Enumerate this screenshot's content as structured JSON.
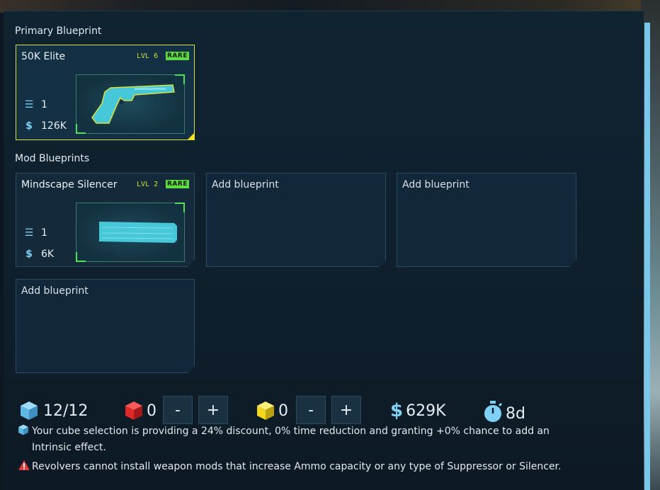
{
  "primary": {
    "section_title": "Primary Blueprint",
    "name": "50K Elite",
    "level": "LVL 6",
    "rarity": "RARE",
    "quantity": "1",
    "price": "126K"
  },
  "mods": {
    "section_title": "Mod Blueprints",
    "items": [
      {
        "name": "Mindscape Silencer",
        "level": "LVL 2",
        "rarity": "RARE",
        "quantity": "1",
        "price": "6K"
      }
    ],
    "add_labels": [
      "Add blueprint",
      "Add blueprint",
      "Add blueprint"
    ]
  },
  "resources": {
    "blue_cubes": "12/12",
    "red_cubes": "0",
    "yellow_cubes": "0",
    "minus_label": "-",
    "plus_label": "+",
    "credits": "629K",
    "time": "8d"
  },
  "notes": {
    "discount_line1": "Your cube selection is providing a 24% discount, 0% time reduction and granting +0% chance to add an",
    "discount_line2": "Intrinsic effect.",
    "warning": "Revolvers cannot install weapon mods that increase Ammo capacity or any type of Suppressor or Silencer."
  },
  "colors": {
    "accent_blue": "#7fd1f5",
    "rare_green": "#5fdc42",
    "primary_border": "#d8e040",
    "warning_red": "#e23b3b"
  },
  "icons": [
    "stack-icon",
    "dollar-icon",
    "cube-icon",
    "timer-icon",
    "warning-icon",
    "revolver-icon",
    "silencer-icon"
  ]
}
